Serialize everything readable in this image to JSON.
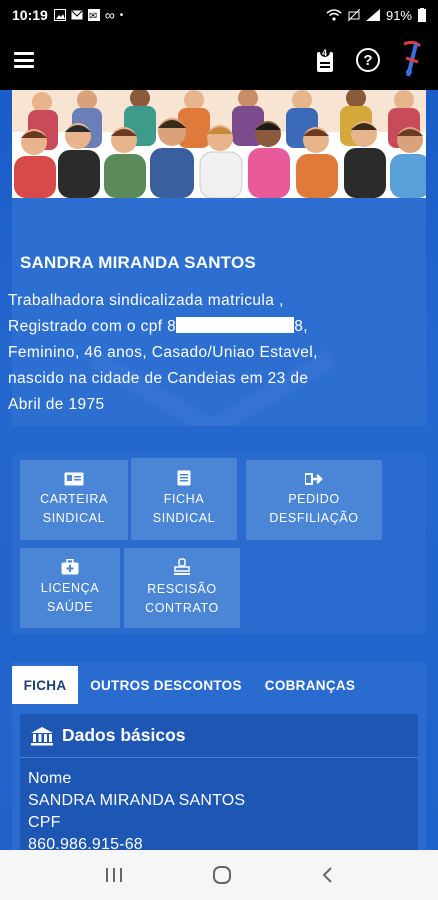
{
  "status_bar": {
    "time": "10:19",
    "battery": "91%"
  },
  "app_bar": {
    "menu_icon": "hamburger-menu-icon",
    "document_icon": "document-icon",
    "help_icon": "help-icon",
    "logo_icon": "union-logo-icon"
  },
  "profile": {
    "name": "SANDRA MIRANDA SANTOS",
    "line1": "Trabalhadora sindicalizada matricula ,",
    "line2_prefix": "Registrado com o cpf 8",
    "line2_suffix": "8,",
    "line3": "Feminino, 46 anos, Casado/Uniao Estavel,",
    "line4": "nascido na cidade de Candeias em 23 de",
    "line5": "Abril de 1975"
  },
  "actions": {
    "carteira_l1": "CARTEIRA",
    "carteira_l2": "SINDICAL",
    "ficha_l1": "FICHA",
    "ficha_l2": "SINDICAL",
    "pedido_l1": "PEDIDO",
    "pedido_l2": "DESFILIAÇÃO",
    "licenca_l1": "LICENÇA",
    "licenca_l2": "SAÚDE",
    "rescisao_l1": "RESCISÃO",
    "rescisao_l2": "CONTRATO"
  },
  "tabs": {
    "ficha": "FICHA",
    "outros": "OUTROS DESCONTOS",
    "cobrancas": "COBRANÇAS"
  },
  "dados": {
    "title": "Dados básicos",
    "nome_label": "Nome",
    "nome_value": "SANDRA MIRANDA SANTOS",
    "cpf_label": "CPF",
    "cpf_value": "860.986.915-68"
  },
  "colors": {
    "app_blue": "#1e5fc4",
    "panel_blue": "#2a6bd0",
    "tile_blue": "#4a85d6",
    "black_bar": "#000000"
  }
}
